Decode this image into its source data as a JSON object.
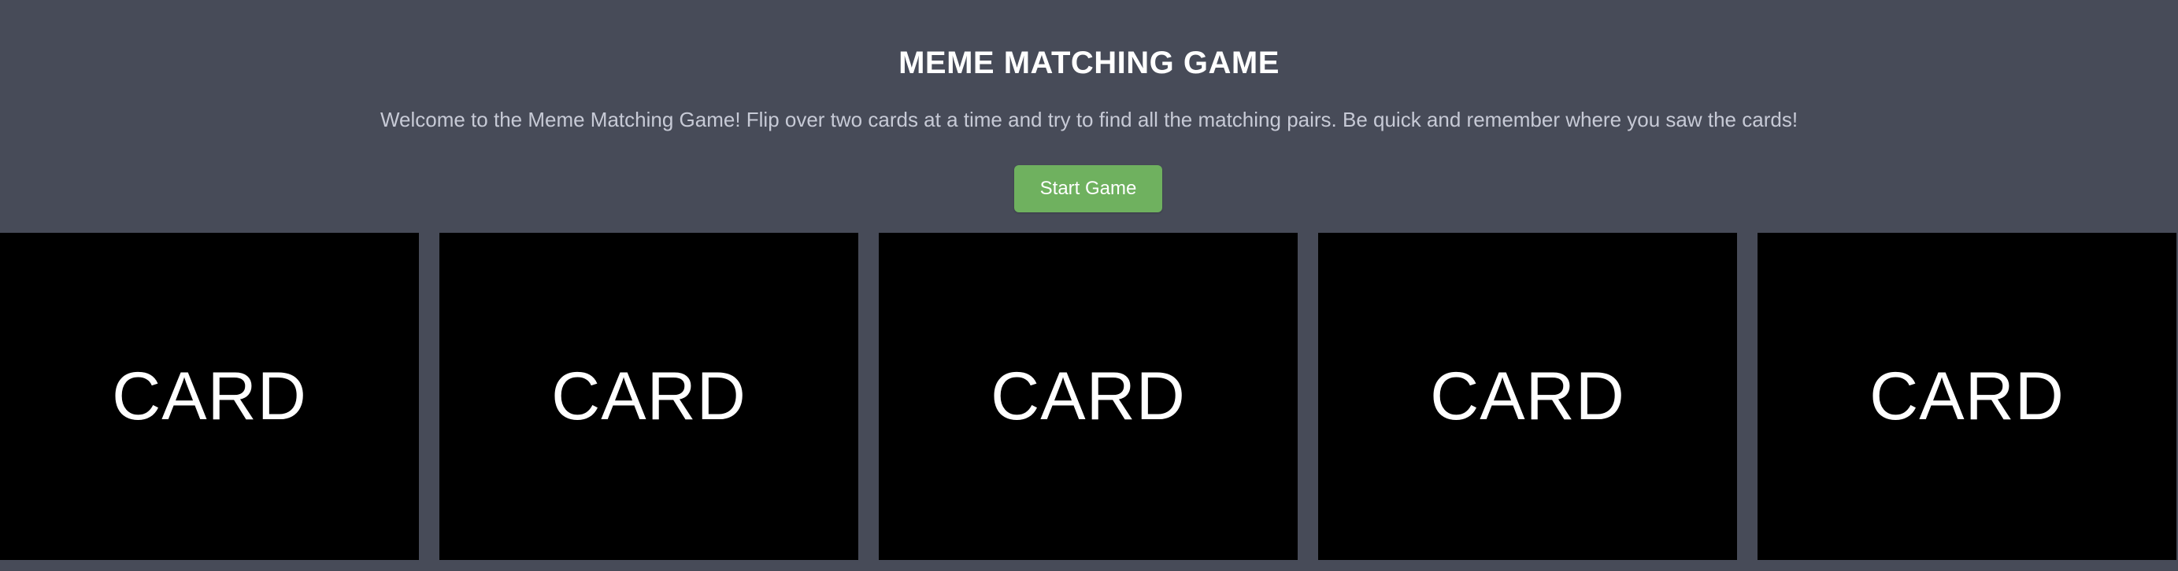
{
  "header": {
    "title": "MEME MATCHING GAME",
    "intro": "Welcome to the Meme Matching Game! Flip over two cards at a time and try to find all the matching pairs. Be quick and remember where you saw the cards!",
    "start_label": "Start Game"
  },
  "cards": [
    {
      "label": "CARD"
    },
    {
      "label": "CARD"
    },
    {
      "label": "CARD"
    },
    {
      "label": "CARD"
    },
    {
      "label": "CARD"
    }
  ],
  "colors": {
    "background": "#474b58",
    "accent": "#6fb15f",
    "card": "#000000",
    "text": "#ffffff",
    "muted_text": "#c7cad6"
  }
}
